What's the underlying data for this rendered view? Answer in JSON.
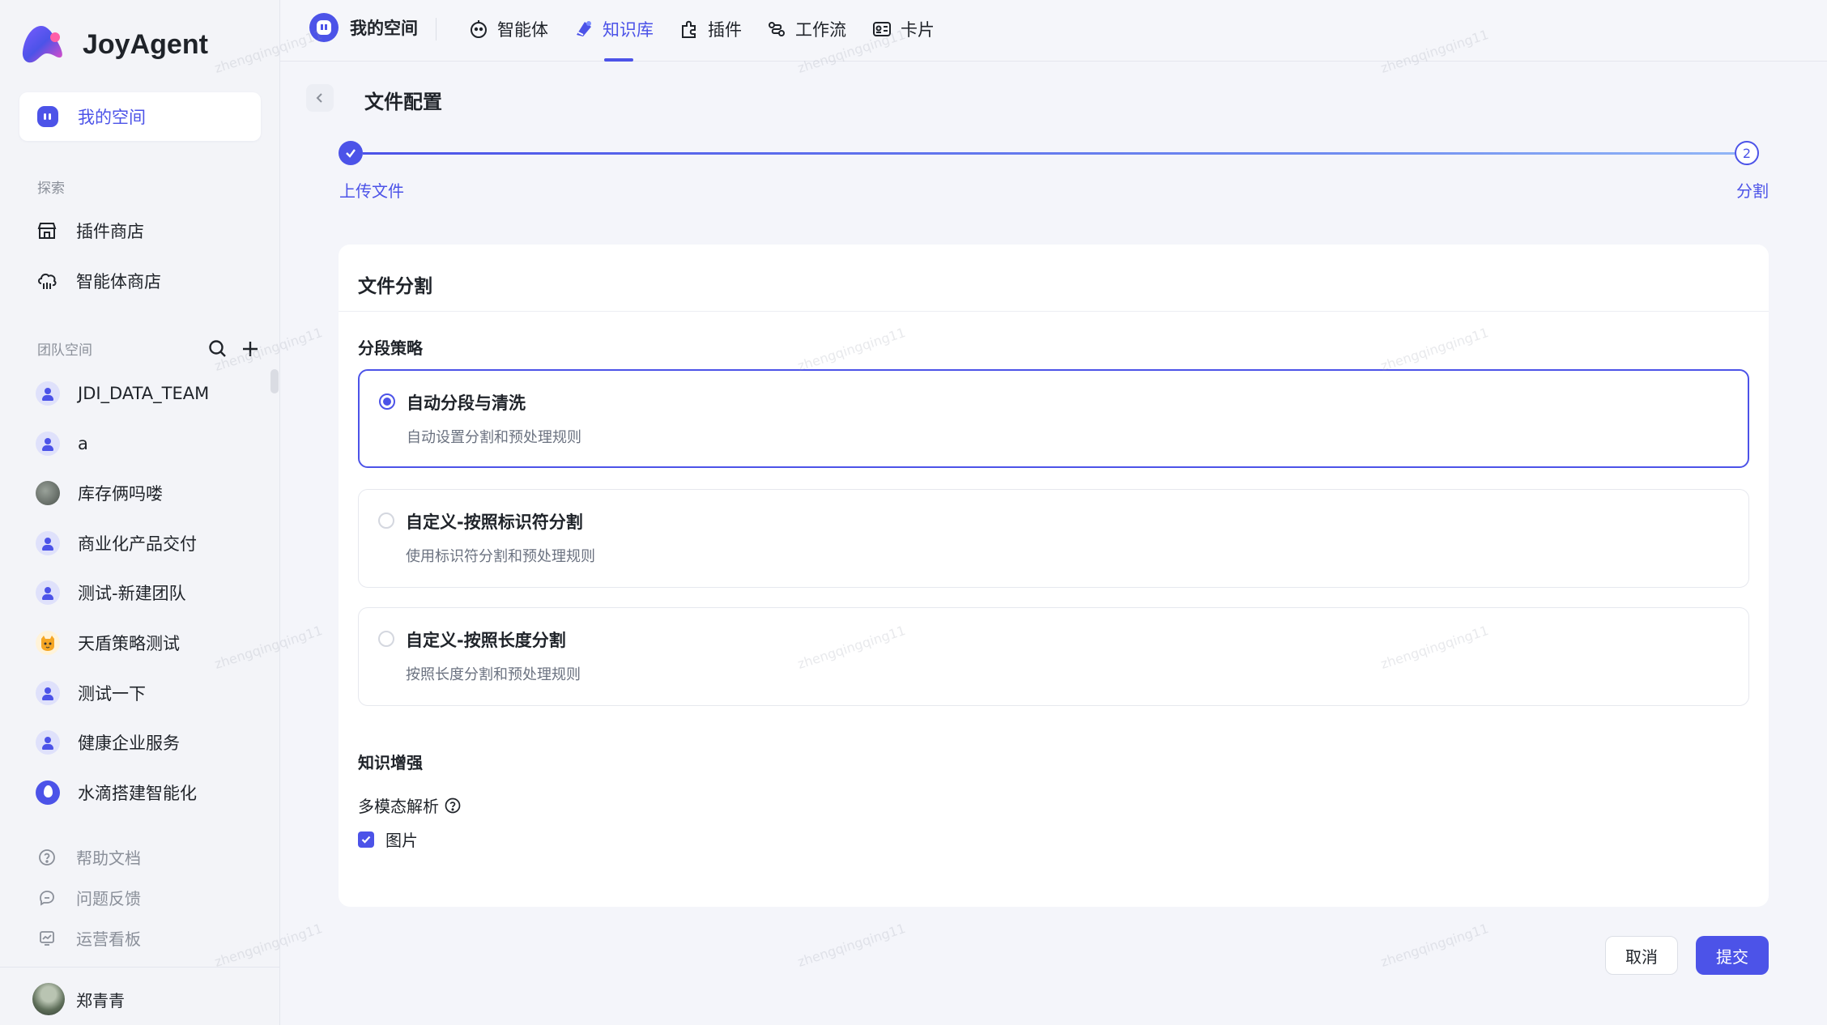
{
  "app": {
    "name": "JoyAgent"
  },
  "sidebar": {
    "my_space": "我的空间",
    "explore_title": "探索",
    "explore_items": [
      {
        "label": "插件商店",
        "icon": "store-icon"
      },
      {
        "label": "智能体商店",
        "icon": "agent-store-icon"
      }
    ],
    "team_title": "团队空间",
    "teams": [
      {
        "label": "JDI_DATA_TEAM",
        "avatar": "person"
      },
      {
        "label": "a",
        "avatar": "person"
      },
      {
        "label": "库存俩吗喽",
        "avatar": "photo"
      },
      {
        "label": "商业化产品交付",
        "avatar": "person"
      },
      {
        "label": "测试-新建团队",
        "avatar": "person"
      },
      {
        "label": "天盾策略测试",
        "avatar": "cat"
      },
      {
        "label": "测试一下",
        "avatar": "person"
      },
      {
        "label": "健康企业服务",
        "avatar": "person"
      },
      {
        "label": "水滴搭建智能化",
        "avatar": "drop"
      }
    ],
    "help_items": [
      {
        "label": "帮助文档",
        "icon": "help-circle-icon"
      },
      {
        "label": "问题反馈",
        "icon": "feedback-icon"
      },
      {
        "label": "运营看板",
        "icon": "dashboard-icon"
      }
    ],
    "user_name": "郑青青"
  },
  "topnav": {
    "space_label": "我的空间",
    "tabs": [
      {
        "label": "智能体",
        "icon": "robot-icon",
        "active": false
      },
      {
        "label": "知识库",
        "icon": "knowledge-icon",
        "active": true
      },
      {
        "label": "插件",
        "icon": "plugin-icon",
        "active": false
      },
      {
        "label": "工作流",
        "icon": "workflow-icon",
        "active": false
      },
      {
        "label": "卡片",
        "icon": "card-icon",
        "active": false
      }
    ]
  },
  "page": {
    "title": "文件配置",
    "steps": [
      {
        "label": "上传文件",
        "status": "done"
      },
      {
        "number": "2",
        "label": "分割",
        "status": "current"
      }
    ]
  },
  "card": {
    "title": "文件分割",
    "strategy_title": "分段策略",
    "options": [
      {
        "title": "自动分段与清洗",
        "desc": "自动设置分割和预处理规则",
        "selected": true
      },
      {
        "title": "自定义-按照标识符分割",
        "desc": "使用标识符分割和预处理规则",
        "selected": false
      },
      {
        "title": "自定义-按照长度分割",
        "desc": "按照长度分割和预处理规则",
        "selected": false
      }
    ],
    "enhance_title": "知识增强",
    "multimodal_label": "多模态解析",
    "image_checkbox_label": "图片",
    "image_checked": true
  },
  "actions": {
    "cancel": "取消",
    "submit": "提交"
  },
  "watermark": "zhengqingqing11",
  "colors": {
    "accent": "#4c53e8",
    "background": "#f4f5fa"
  }
}
